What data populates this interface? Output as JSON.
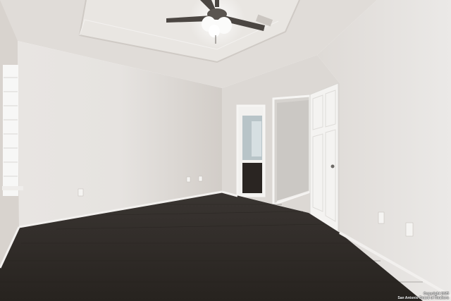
{
  "scene": {
    "description_tag": "empty-bedroom-photo",
    "colors": {
      "ceiling": "#e4e0dc",
      "wall_left": "#dcd8d4",
      "wall_back": "#d6d2ce",
      "wall_right": "#e2dfdc",
      "floor": "#2e2a27",
      "baseboard": "#f2f0ee",
      "door": "#f4f3f1"
    }
  },
  "watermark": {
    "line1": "Copyright 2025",
    "line2": "San Antonio Board of Realtors"
  }
}
